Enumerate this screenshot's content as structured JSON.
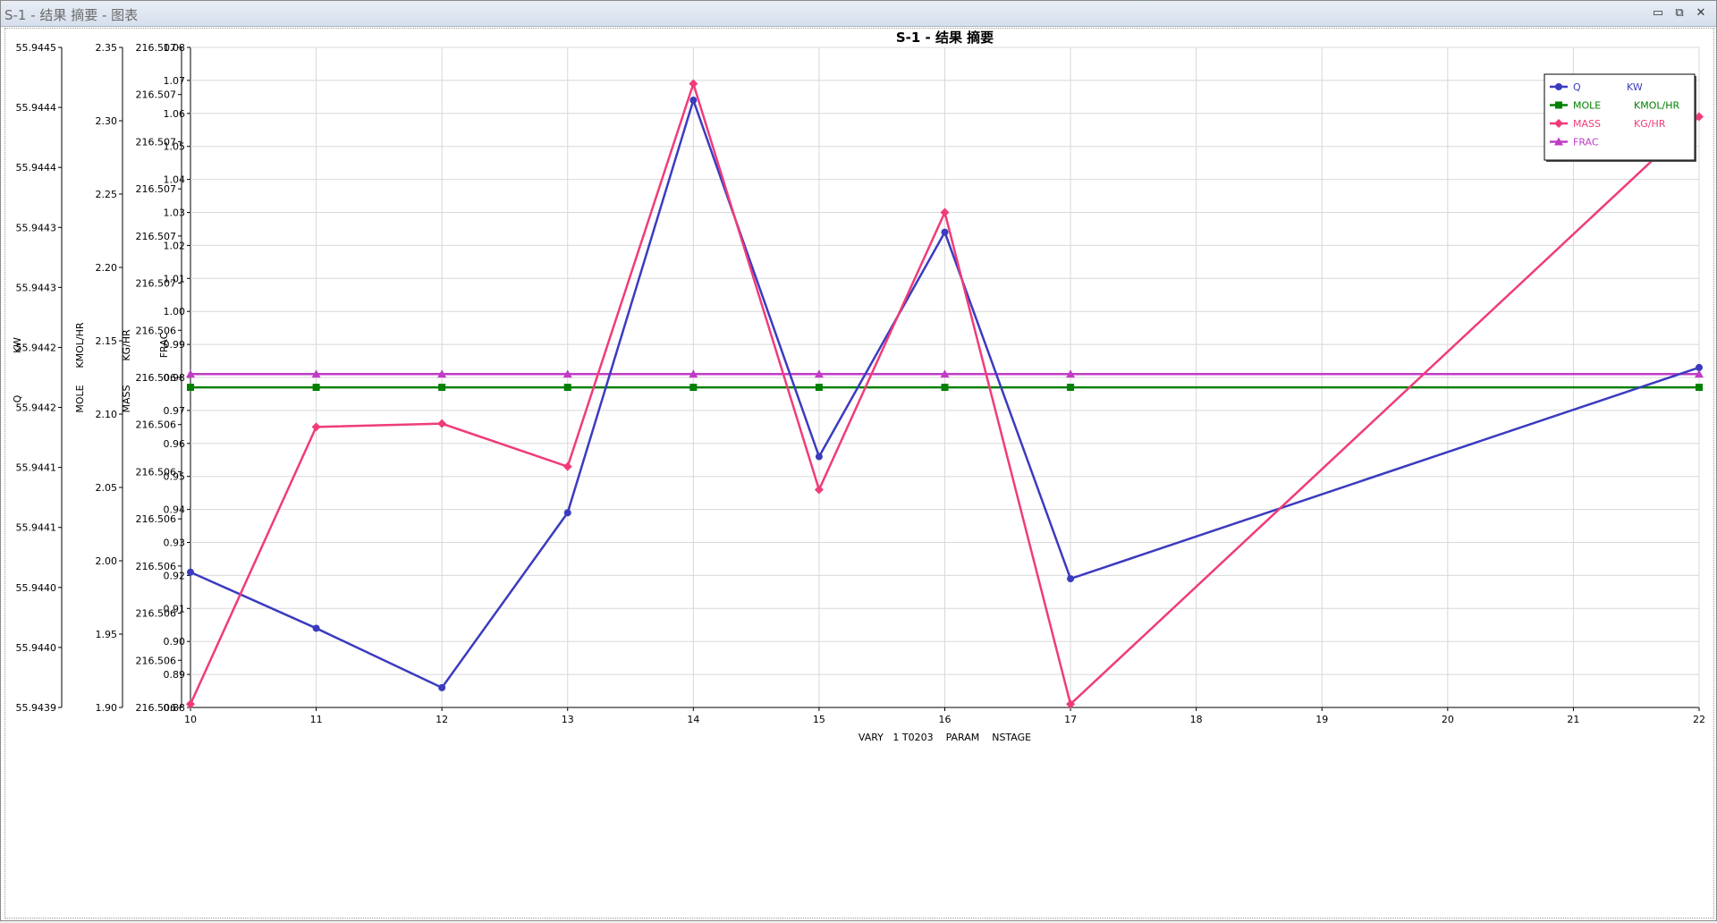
{
  "window": {
    "title": "S-1 - 结果 摘要 - 图表",
    "minimize_label": "▭",
    "restore_label": "⧉",
    "close_label": "✕"
  },
  "colors": {
    "q": "#3b3bbf",
    "mole": "#008000",
    "mass": "#f03b7a",
    "frac": "#c03cc6",
    "grid": "#d8d8d8",
    "axis": "#000000"
  },
  "chart_data": {
    "type": "line",
    "title": "S-1 - 结果 摘要",
    "xlabel": "VARY   1 T0203    PARAM    NSTAGE",
    "x": [
      10,
      11,
      12,
      13,
      14,
      15,
      16,
      17,
      22
    ],
    "xlim": [
      10,
      22
    ],
    "x_ticks": [
      "10",
      "11",
      "12",
      "13",
      "14",
      "15",
      "16",
      "17",
      "18",
      "19",
      "20",
      "21",
      "22"
    ],
    "grid": true,
    "legend_position": "top-right",
    "y_axes": [
      {
        "id": "q",
        "label": "Q",
        "unit": "KW",
        "ylim": [
          55.9439,
          55.94445
        ],
        "tick_labels": [
          "55.9445",
          "55.9444",
          "55.9444",
          "55.9443",
          "55.9443",
          "55.9442",
          "55.9442",
          "55.9441",
          "55.9441",
          "55.9440",
          "55.9440",
          "55.9439"
        ]
      },
      {
        "id": "mole",
        "label": "MOLE",
        "unit": "KMOL/HR",
        "ylim": [
          1.9,
          2.35
        ],
        "tick_labels": [
          "2.35",
          "2.30",
          "2.25",
          "2.20",
          "2.15",
          "2.10",
          "2.05",
          "2.00",
          "1.95",
          "1.90"
        ]
      },
      {
        "id": "mass",
        "label": "MASS",
        "unit": "KG/HR",
        "ylim": [
          216.506,
          216.507
        ],
        "tick_labels": [
          "216.507",
          "216.507",
          "216.507",
          "216.507",
          "216.507",
          "216.507",
          "216.506",
          "216.506",
          "216.506",
          "216.506",
          "216.506",
          "216.506",
          "216.506",
          "216.506",
          "216.506"
        ]
      },
      {
        "id": "frac",
        "label": "FRAC",
        "unit": "",
        "ylim": [
          0.88,
          1.08
        ],
        "tick_labels": [
          "1.08",
          "1.07",
          "1.06",
          "1.05",
          "1.04",
          "1.03",
          "1.02",
          "1.01",
          "1.00",
          "0.99",
          "0.98",
          "0.97",
          "0.96",
          "0.95",
          "0.94",
          "0.93",
          "0.92",
          "0.91",
          "0.90",
          "0.89",
          "0.88"
        ]
      }
    ],
    "series": [
      {
        "name": "Q",
        "unit": "KW",
        "axis": "q",
        "marker": "circle",
        "values": [
          0.921,
          0.904,
          0.886,
          0.939,
          1.064,
          0.956,
          1.024,
          0.919,
          0.983
        ]
      },
      {
        "name": "MOLE",
        "unit": "KMOL/HR",
        "axis": "mole",
        "marker": "square",
        "values": [
          0.977,
          0.977,
          0.977,
          0.977,
          0.977,
          0.977,
          0.977,
          0.977,
          0.977
        ]
      },
      {
        "name": "MASS",
        "unit": "KG/HR",
        "axis": "mass",
        "marker": "diamond",
        "values": [
          0.881,
          0.965,
          0.966,
          0.953,
          1.069,
          0.946,
          1.03,
          0.881,
          1.059
        ]
      },
      {
        "name": "FRAC",
        "unit": "",
        "axis": "frac",
        "marker": "triangle",
        "values": [
          0.981,
          0.981,
          0.981,
          0.981,
          0.981,
          0.981,
          0.981,
          0.981,
          0.981
        ]
      }
    ]
  }
}
